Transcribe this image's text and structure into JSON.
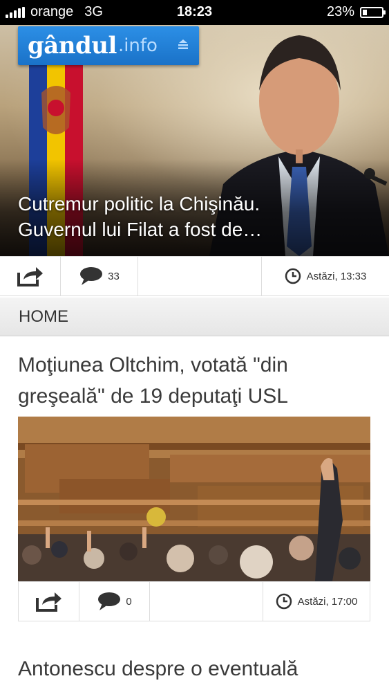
{
  "status_bar": {
    "carrier": "orange",
    "network": "3G",
    "time": "18:23",
    "battery": "23%",
    "battery_level": 0.23
  },
  "brand": {
    "logo_name": "gândul",
    "logo_tld": ".info",
    "color": "#1f7fd6"
  },
  "hero": {
    "title": "Cutremur politic la Chişinău. Guvernul lui Filat a fost de…",
    "comment_count": "33",
    "timestamp": "Astăzi, 13:33"
  },
  "section": {
    "title": "HOME"
  },
  "articles": [
    {
      "title": "Moţiunea Oltchim, votată \"din greşeală\" de 19 deputaţi USL",
      "comment_count": "0",
      "timestamp": "Astăzi, 17:00"
    },
    {
      "title": "Antonescu despre o eventuală"
    }
  ],
  "icons": {
    "share": "share-icon",
    "comments": "comments-icon",
    "clock": "clock-icon"
  }
}
